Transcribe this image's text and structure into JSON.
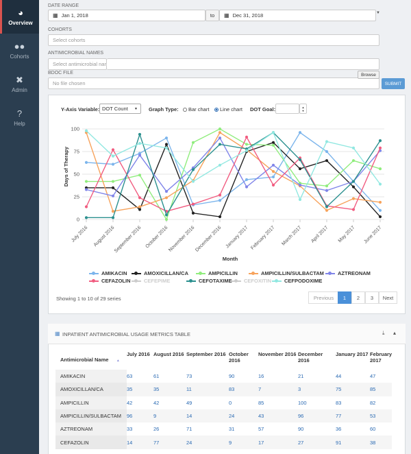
{
  "nav": [
    {
      "label": "Overview",
      "icon": "gauge-icon"
    },
    {
      "label": "Cohorts",
      "icon": "users-icon"
    },
    {
      "label": "Admin",
      "icon": "tools-icon"
    },
    {
      "label": "Help",
      "icon": "question-icon"
    }
  ],
  "filters": {
    "date_range_label": "DATE RANGE",
    "date_from": "Jan 1, 2018",
    "date_to_sep": "to",
    "date_to": "Dec 31, 2018",
    "cohorts_label": "COHORTS",
    "cohorts_placeholder": "Select cohorts",
    "antimicrobials_label": "ANTIMICROBIAL NAMES",
    "antimicrobials_placeholder": "Select antimicrobial name",
    "bdoc_label": "BDOC FILE",
    "file_placeholder": "No file chosen",
    "browse_label": "Browse",
    "submit_label": "SUBMIT"
  },
  "chart_controls": {
    "y_axis_label": "Y-Axis Variable:",
    "y_axis_value": "DOT Count",
    "graph_type_label": "Graph Type:",
    "bar_label": "Bar chart",
    "line_label": "Line chart",
    "dot_goal_label": "DOT Goal:"
  },
  "chart_data": {
    "type": "line",
    "xlabel": "Month",
    "ylabel": "Days of Therapy",
    "ylim": [
      0,
      100
    ],
    "yticks": [
      0,
      25,
      50,
      75,
      100
    ],
    "grid": true,
    "legend": "bottom",
    "categories": [
      "July 2016",
      "August 2016",
      "September 2016",
      "October 2016",
      "November 2016",
      "December 2016",
      "January 2017",
      "February 2017",
      "March 2017",
      "April 2017",
      "May 2017",
      "June 2017"
    ],
    "series": [
      {
        "name": "AMIKACIN",
        "color": "#7cb5ec",
        "values": [
          63,
          61,
          73,
          90,
          16,
          21,
          44,
          47,
          96,
          75,
          42,
          10
        ]
      },
      {
        "name": "AMOXICILLAN/CA",
        "color": "#222222",
        "values": [
          35,
          35,
          11,
          83,
          7,
          3,
          75,
          85,
          56,
          65,
          36,
          3
        ]
      },
      {
        "name": "AMPICILLIN",
        "color": "#90ed7d",
        "values": [
          42,
          42,
          49,
          0,
          85,
          100,
          83,
          82,
          40,
          37,
          65,
          56
        ]
      },
      {
        "name": "AMPICILLIN/SULBACTAM",
        "color": "#f7a35c",
        "values": [
          96,
          9,
          14,
          24,
          43,
          96,
          77,
          53,
          37,
          10,
          23,
          19
        ]
      },
      {
        "name": "AZTREONAM",
        "color": "#8085e9",
        "values": [
          33,
          26,
          71,
          31,
          57,
          90,
          36,
          60,
          38,
          32,
          42,
          76
        ]
      },
      {
        "name": "CEFAZOLIN",
        "color": "#f15c80",
        "values": [
          14,
          77,
          24,
          9,
          17,
          27,
          91,
          38,
          68,
          15,
          11,
          79
        ]
      },
      {
        "name": "CEFEPIME",
        "color": "#cccccc",
        "hidden": true,
        "values": []
      },
      {
        "name": "CEFOTAXIME",
        "color": "#2b908f",
        "values": [
          2,
          2,
          94,
          5,
          55,
          83,
          78,
          96,
          66,
          14,
          42,
          87
        ]
      },
      {
        "name": "CEFOXITIN",
        "color": "#cccccc",
        "hidden": true,
        "values": []
      },
      {
        "name": "CEFPODOXIME",
        "color": "#91e8e1",
        "values": [
          98,
          70,
          84,
          79,
          42,
          60,
          76,
          96,
          22,
          86,
          79,
          39
        ]
      }
    ]
  },
  "pagination": {
    "summary": "Showing 1 to 10 of 29 series",
    "prev": "Previous",
    "pages": [
      "1",
      "2",
      "3"
    ],
    "next": "Next"
  },
  "table": {
    "title": "INPATIENT ANTIMICROBIAL USAGE METRICS TABLE",
    "columns": [
      "Antimicrobial Name",
      "July 2016",
      "August 2016",
      "September 2016",
      "October 2016",
      "November 2016",
      "December 2016",
      "January 2017",
      "February 2017"
    ],
    "rows": [
      [
        "AMIKACIN",
        "63",
        "61",
        "73",
        "90",
        "16",
        "21",
        "44",
        "47"
      ],
      [
        "AMOXICILLAN/CA",
        "35",
        "35",
        "11",
        "83",
        "7",
        "3",
        "75",
        "85"
      ],
      [
        "AMPICILLIN",
        "42",
        "42",
        "49",
        "0",
        "85",
        "100",
        "83",
        "82"
      ],
      [
        "AMPICILLIN/SULBACTAM",
        "96",
        "9",
        "14",
        "24",
        "43",
        "96",
        "77",
        "53"
      ],
      [
        "AZTREONAM",
        "33",
        "26",
        "71",
        "31",
        "57",
        "90",
        "36",
        "60"
      ],
      [
        "CEFAZOLIN",
        "14",
        "77",
        "24",
        "9",
        "17",
        "27",
        "91",
        "38"
      ]
    ]
  }
}
